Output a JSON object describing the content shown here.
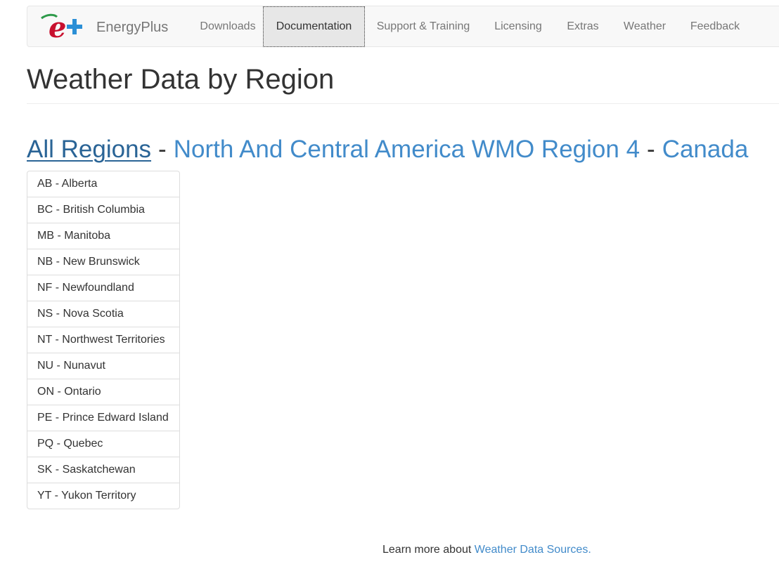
{
  "navbar": {
    "brand": {
      "name": "EnergyPlus",
      "logo_icon": "energyplus-logo-icon"
    },
    "items": [
      {
        "label": "Downloads",
        "active": false
      },
      {
        "label": "Documentation",
        "active": true
      },
      {
        "label": "Support & Training",
        "active": false
      },
      {
        "label": "Licensing",
        "active": false
      },
      {
        "label": "Extras",
        "active": false
      },
      {
        "label": "Weather",
        "active": false
      },
      {
        "label": "Feedback",
        "active": false
      }
    ]
  },
  "page": {
    "title": "Weather Data by Region"
  },
  "breadcrumb": {
    "items": [
      {
        "label": "All Regions"
      },
      {
        "label": "North And Central America WMO Region 4"
      },
      {
        "label": "Canada"
      }
    ],
    "separator": "-"
  },
  "regions": [
    {
      "label": "AB - Alberta"
    },
    {
      "label": "BC - British Columbia"
    },
    {
      "label": "MB - Manitoba"
    },
    {
      "label": "NB - New Brunswick"
    },
    {
      "label": "NF - Newfoundland"
    },
    {
      "label": "NS - Nova Scotia"
    },
    {
      "label": "NT - Northwest Territories"
    },
    {
      "label": "NU - Nunavut"
    },
    {
      "label": "ON - Ontario"
    },
    {
      "label": "PE - Prince Edward Island"
    },
    {
      "label": "PQ - Quebec"
    },
    {
      "label": "SK - Saskatchewan"
    },
    {
      "label": "YT - Yukon Territory"
    }
  ],
  "footer": {
    "prefix": "Learn more about ",
    "link_label": "Weather Data Sources."
  },
  "colors": {
    "link": "#428bca",
    "logo_red": "#c8102e",
    "logo_blue": "#2b8fd6",
    "logo_green": "#2e9a4a"
  }
}
